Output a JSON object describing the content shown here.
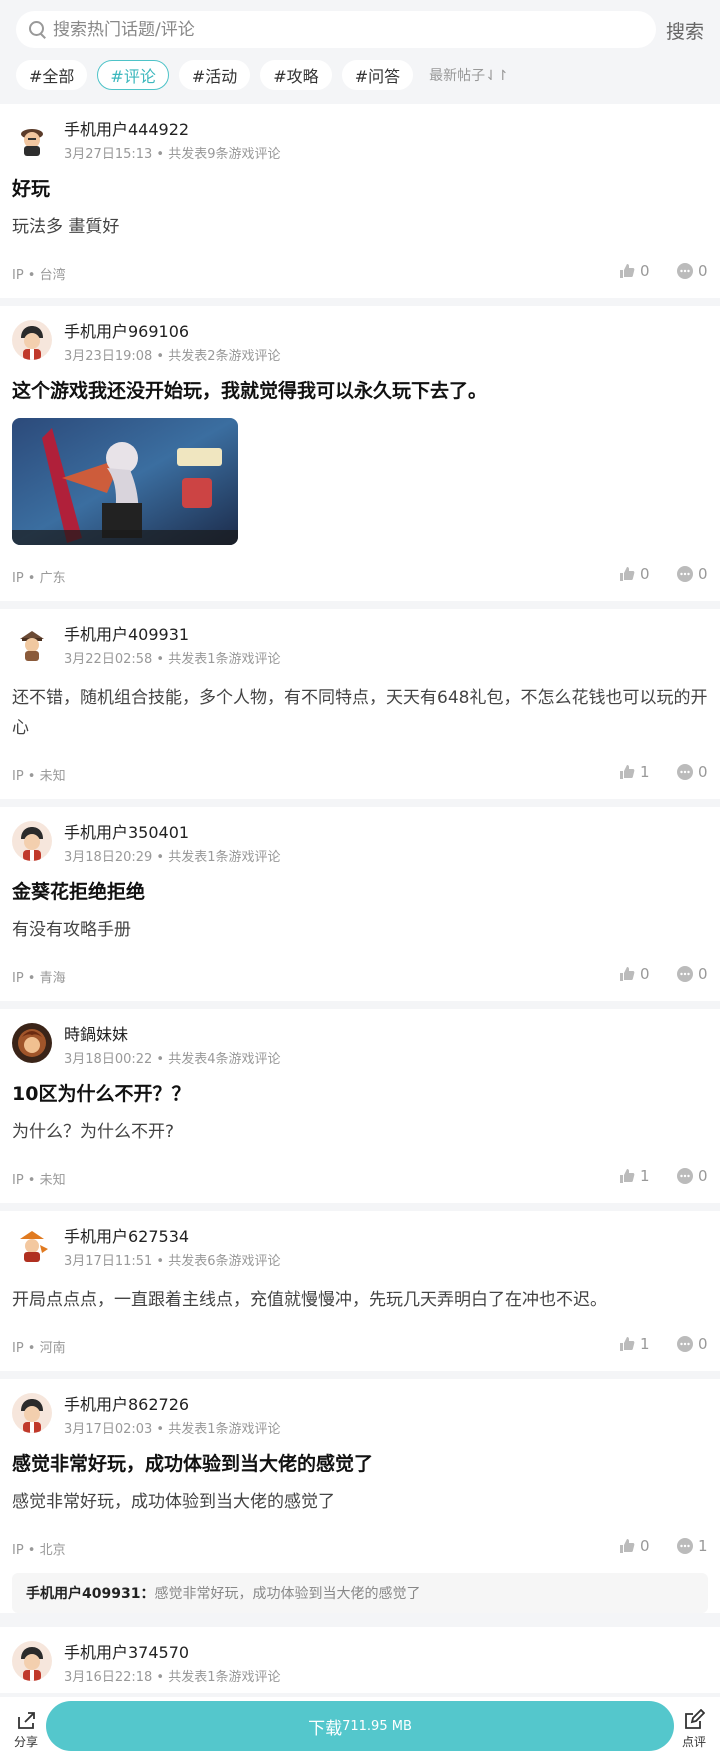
{
  "search": {
    "placeholder": "搜索热门话题/评论",
    "button": "搜索"
  },
  "tags": [
    {
      "label": "#全部",
      "active": false
    },
    {
      "label": "#评论",
      "active": true
    },
    {
      "label": "#活动",
      "active": false
    },
    {
      "label": "#攻略",
      "active": false
    },
    {
      "label": "#问答",
      "active": false
    }
  ],
  "sort_label": "最新帖子⇃↾",
  "posts": [
    {
      "user": "手机用户444922",
      "meta": "3月27日15:13 • 共发表9条游戏评论",
      "title": "好玩",
      "body": "玩法多 畫質好",
      "ip": "IP • 台湾",
      "likes": "0",
      "comments": "0"
    },
    {
      "user": "手机用户969106",
      "meta": "3月23日19:08 • 共发表2条游戏评论",
      "title": "这个游戏我还没开始玩，我就觉得我可以永久玩下去了。",
      "ip": "IP • 广东",
      "likes": "0",
      "comments": "0"
    },
    {
      "user": "手机用户409931",
      "meta": "3月22日02:58 • 共发表1条游戏评论",
      "body": "还不错，随机组合技能，多个人物，有不同特点，天天有648礼包，不怎么花钱也可以玩的开心",
      "ip": "IP • 未知",
      "likes": "1",
      "comments": "0"
    },
    {
      "user": "手机用户350401",
      "meta": "3月18日20:29 • 共发表1条游戏评论",
      "title": "金葵花拒绝拒绝",
      "body": "有没有攻略手册",
      "ip": "IP • 青海",
      "likes": "0",
      "comments": "0"
    },
    {
      "user": "時鍋妹妹",
      "meta": "3月18日00:22 • 共发表4条游戏评论",
      "title": "10区为什么不开？？",
      "body": "为什么？为什么不开?",
      "ip": "IP • 未知",
      "likes": "1",
      "comments": "0"
    },
    {
      "user": "手机用户627534",
      "meta": "3月17日11:51 • 共发表6条游戏评论",
      "body": "开局点点点，一直跟着主线点，充值就慢慢冲，先玩几天弄明白了在冲也不迟。",
      "ip": "IP • 河南",
      "likes": "1",
      "comments": "0"
    },
    {
      "user": "手机用户862726",
      "meta": "3月17日02:03 • 共发表1条游戏评论",
      "title": "感觉非常好玩，成功体验到当大佬的感觉了",
      "body": "感觉非常好玩，成功体验到当大佬的感觉了",
      "ip": "IP • 北京",
      "likes": "0",
      "comments": "1",
      "reply_user": "手机用户409931：",
      "reply_text": "感觉非常好玩，成功体验到当大佬的感觉了"
    },
    {
      "user": "手机用户374570",
      "meta": "3月16日22:18 • 共发表1条游戏评论"
    }
  ],
  "bottom": {
    "share": "分享",
    "download": "下载",
    "size": "711.95 MB",
    "review": "点评"
  },
  "colors": {
    "accent": "#54c7cc",
    "tag_active": "#3bb7bd"
  }
}
